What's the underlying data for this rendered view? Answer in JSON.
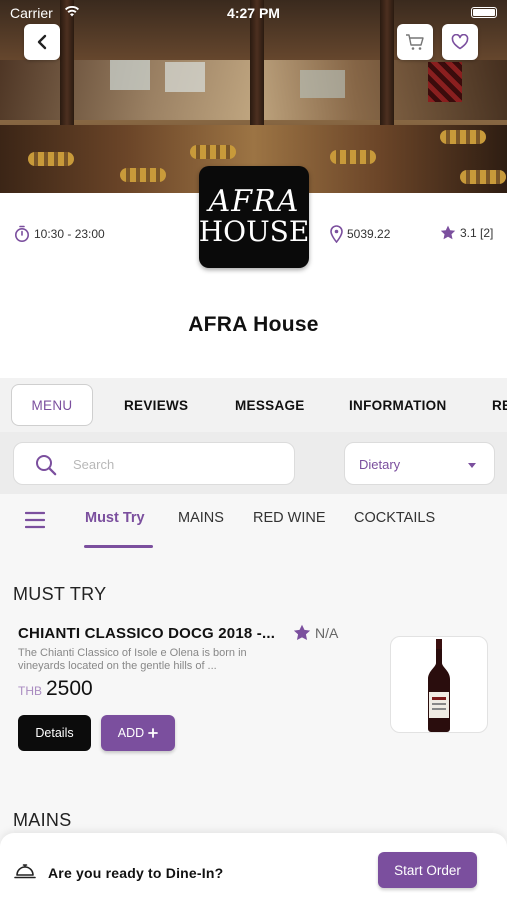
{
  "status_bar": {
    "carrier": "Carrier",
    "time": "4:27 PM"
  },
  "restaurant": {
    "logo_line1": "AFRA",
    "logo_line2": "HOUSE",
    "hours": "10:30 - 23:00",
    "distance": "5039.22",
    "rating": "3.1 [2]",
    "name": "AFRA House"
  },
  "tabs": [
    "MENU",
    "REVIEWS",
    "MESSAGE",
    "INFORMATION",
    "RE"
  ],
  "search": {
    "placeholder": "Search",
    "dietary": "Dietary"
  },
  "categories": [
    "Must Try",
    "MAINS",
    "RED WINE",
    "COCKTAILS"
  ],
  "sections": {
    "must_try": "MUST TRY",
    "mains": "MAINS"
  },
  "item": {
    "name": "CHIANTI CLASSICO DOCG 2018 -...",
    "rating": "N/A",
    "desc_line1": "The Chianti Classico of Isole e Olena is born in",
    "desc_line2": "vineyards located on the gentle hills of ...",
    "currency": "THB",
    "price": "2500",
    "details_label": "Details",
    "add_label": "ADD"
  },
  "bottom_bar": {
    "question": "Are you ready to Dine-In?",
    "start_label": "Start Order"
  },
  "colors": {
    "accent": "#7b4f9e",
    "dark": "#0c0c0c"
  },
  "icons": [
    "back-icon",
    "cart-icon",
    "heart-icon",
    "timer-icon",
    "location-pin-icon",
    "star-icon",
    "search-icon",
    "menu-hamburger-icon",
    "dine-bell-icon",
    "plus-icon"
  ]
}
